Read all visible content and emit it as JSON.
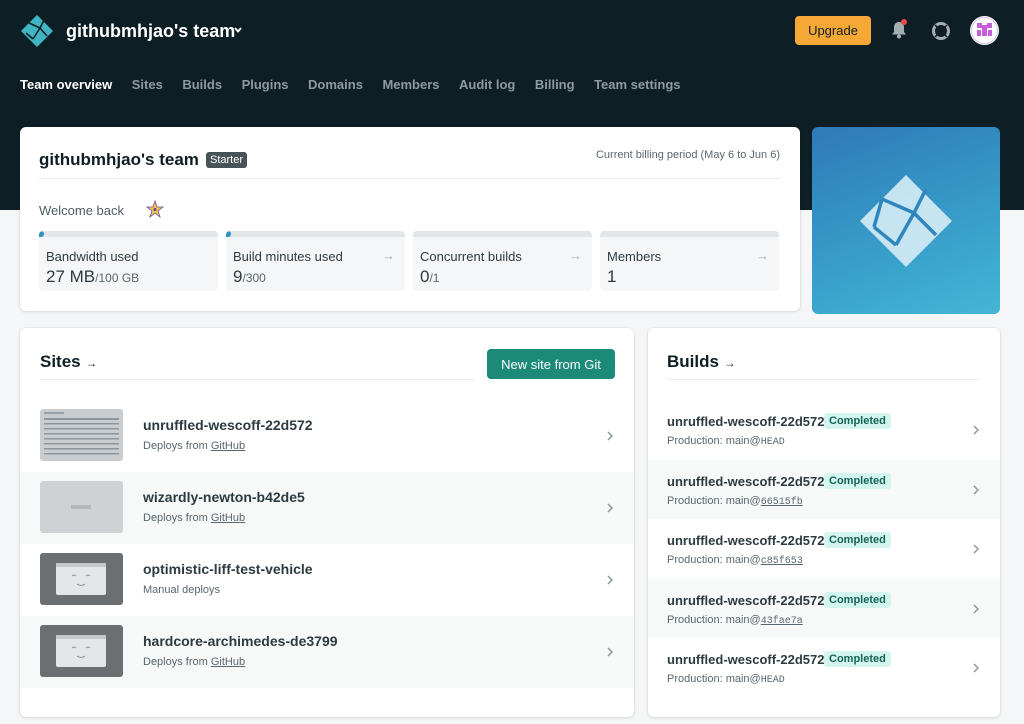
{
  "header": {
    "team_name": "githubmhjao's team",
    "upgrade_label": "Upgrade"
  },
  "nav": {
    "items": [
      "Team overview",
      "Sites",
      "Builds",
      "Plugins",
      "Domains",
      "Members",
      "Audit log",
      "Billing",
      "Team settings"
    ],
    "active": "Team overview"
  },
  "summary": {
    "title": "githubmhjao's team",
    "plan_badge": "Starter",
    "billing_period": "Current billing period (May 6 to Jun 6)",
    "welcome": "Welcome back",
    "stats": [
      {
        "label": "Bandwidth used",
        "value": "27 MB",
        "limit": "/100 GB",
        "fraction": 0.0003
      },
      {
        "label": "Build minutes used",
        "value": "9",
        "limit": "/300",
        "fraction": 0.03
      },
      {
        "label": "Concurrent builds",
        "value": "0",
        "limit": "/1",
        "fraction": 0
      },
      {
        "label": "Members",
        "value": "1",
        "limit": "",
        "fraction": 0
      }
    ]
  },
  "sites": {
    "title": "Sites",
    "new_site_label": "New site from Git",
    "items": [
      {
        "name": "unruffled-wescoff-22d572",
        "deploy_prefix": "Deploys from ",
        "deploy_link": "GitHub"
      },
      {
        "name": "wizardly-newton-b42de5",
        "deploy_prefix": "Deploys from ",
        "deploy_link": "GitHub"
      },
      {
        "name": "optimistic-liff-test-vehicle",
        "deploy_prefix": "Manual deploys",
        "deploy_link": ""
      },
      {
        "name": "hardcore-archimedes-de3799",
        "deploy_prefix": "Deploys from ",
        "deploy_link": "GitHub"
      }
    ]
  },
  "builds": {
    "title": "Builds",
    "items": [
      {
        "site": "unruffled-wescoff-22d572",
        "status": "Completed",
        "context": "Production: ",
        "branch": "main@",
        "ref": "HEAD",
        "ref_link": false
      },
      {
        "site": "unruffled-wescoff-22d572",
        "status": "Completed",
        "context": "Production: ",
        "branch": "main@",
        "ref": "66515fb",
        "ref_link": true
      },
      {
        "site": "unruffled-wescoff-22d572",
        "status": "Completed",
        "context": "Production: ",
        "branch": "main@",
        "ref": "c85f653",
        "ref_link": true
      },
      {
        "site": "unruffled-wescoff-22d572",
        "status": "Completed",
        "context": "Production: ",
        "branch": "main@",
        "ref": "43fae7a",
        "ref_link": true
      },
      {
        "site": "unruffled-wescoff-22d572",
        "status": "Completed",
        "context": "Production: ",
        "branch": "main@",
        "ref": "HEAD",
        "ref_link": false
      }
    ]
  },
  "colors": {
    "header_bg": "#0e1e25",
    "upgrade": "#f6a837",
    "primary_button": "#1b8a79",
    "completed_badge": "#d4f5ef"
  }
}
